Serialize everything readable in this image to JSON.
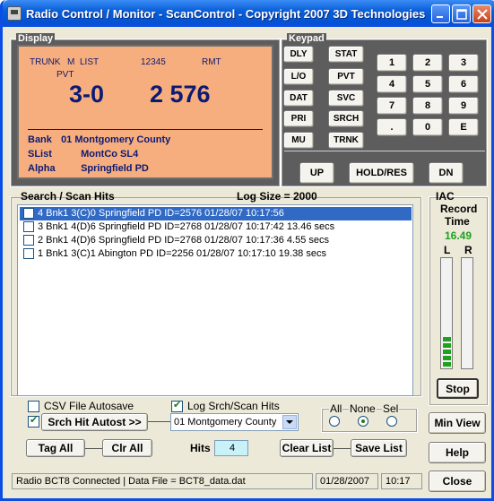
{
  "window": {
    "title": "Radio Control / Monitor - ScanControl - Copyright 2007 3D Technologies"
  },
  "display": {
    "group_label": "Display",
    "mode": "TRUNK",
    "mode_flag": "M",
    "list_label": "LIST",
    "list_value": "12345",
    "rmt": "RMT",
    "pvt": "PVT",
    "channel": "3-0",
    "talkgroup": "2 576",
    "bank_label": "Bank",
    "bank_value": "01 Montgomery County",
    "slist_label": "SList",
    "slist_value": "MontCo SL4",
    "alpha_label": "Alpha",
    "alpha_value": "Springfield PD"
  },
  "keypad": {
    "group_label": "Keypad",
    "func_col1": [
      "DLY",
      "L/O",
      "DAT",
      "PRI",
      "MU"
    ],
    "func_col2": [
      "STAT",
      "PVT",
      "SVC",
      "SRCH",
      "TRNK"
    ],
    "numbers": [
      "1",
      "2",
      "3",
      "4",
      "5",
      "6",
      "7",
      "8",
      "9",
      ".",
      "0",
      "E"
    ],
    "up": "UP",
    "hold": "HOLD/RES",
    "dn": "DN"
  },
  "hits": {
    "group_label": "Search / Scan Hits",
    "log_size": "Log Size = 2000",
    "rows": [
      "4  Bnk1 3(C)0  Springfield PD  ID=2576  01/28/07  10:17:56",
      "3  Bnk1 4(D)6  Springfield PD  ID=2768  01/28/07  10:17:42  13.46 secs",
      "2  Bnk1 4(D)6  Springfield PD  ID=2768  01/28/07  10:17:36  4.55 secs",
      "1  Bnk1 3(C)1  Abington PD  ID=2256  01/28/07  10:17:10  19.38 secs"
    ],
    "selected_index": 0
  },
  "iac": {
    "group_label": "IAC",
    "record_label": "Record",
    "time_label": "Time",
    "time_value": "16.49",
    "l_label": "L",
    "r_label": "R",
    "l_level": 0.27,
    "r_level": 0,
    "stop": "Stop"
  },
  "controls": {
    "csv_autosave": "CSV File Autosave",
    "csv_checked": false,
    "log_hits": "Log Srch/Scan Hits",
    "log_checked": true,
    "srch_autost": "Srch Hit Autost >>",
    "srch_checked": true,
    "bank_select": "01 Montgomery County",
    "all": "All",
    "none": "None",
    "sel": "Sel",
    "radio_selected": "None",
    "tag_all": "Tag All",
    "clr_all": "Clr All",
    "hits_label": "Hits",
    "hits_value": "4",
    "clear_list": "Clear List",
    "save_list": "Save List",
    "min_view": "Min View",
    "help": "Help",
    "close": "Close"
  },
  "status": {
    "connection": "Radio BCT8 Connected | Data File = BCT8_data.dat",
    "date": "01/28/2007",
    "time": "10:17"
  }
}
